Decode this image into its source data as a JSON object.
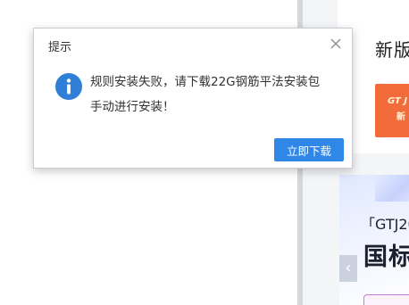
{
  "background": {
    "right_panel_title": "新版",
    "promo_tile_text": "GT J",
    "promo_tile_subtext": "新",
    "banner_subtitle": "「GTJ20",
    "banner_title": "国标",
    "banner_prev_glyph": "‹"
  },
  "dialog": {
    "title": "提示",
    "close_icon": "close-icon",
    "info_icon": "info-icon",
    "message_line1": "规则安装失败，请下载22G钢筋平法安装包",
    "message_line2": "手动进行安装！",
    "download_button_label": "立即下载",
    "accent_color": "#2f88e8"
  }
}
